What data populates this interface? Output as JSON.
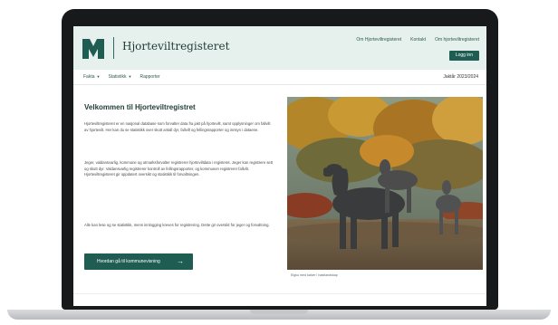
{
  "site": {
    "title": "Hjorteviltregisteret"
  },
  "header": {
    "links": [
      "Om Hjorteviltregisteret",
      "Kontakt",
      "Om hjorteviltregisteret"
    ],
    "login_label": "Logg inn"
  },
  "nav": {
    "items": [
      {
        "label": "Fakta",
        "has_dropdown": true
      },
      {
        "label": "Statistikk",
        "has_dropdown": true
      },
      {
        "label": "Rapporter",
        "has_dropdown": false
      }
    ],
    "hunt_year": "Jaktår 2023/2024"
  },
  "main": {
    "title": "Velkommen til Hjorteviltregistret",
    "paragraphs": [
      "Hjorteviltregisteret er en nasjonal database som forvalter data fra jakt på hjortevilt, samt opplysninger om fallvilt av hjortevilt. Her kan du se statistikk over skutt antall dyr, fallvilt og fellingsrapporter og innsyn i dataene.",
      "Jeger, valdansvarlig, kommune og utmarksforvalter registrerer hjorteviltdata i registeret. Jeger kan registrere sett og skutt dyr. Valdansvarlig registrerer kontroll av fellingsrapporter, og kommunen registrerer fallvilt. Hjorteviltregisteret gir oppdatert oversikt og statistikk til forvaltningen.",
      "Alle kan lese og se statistikk, mens innlogging kreves for registrering. Dette gir oversikt for jeger og forvaltning."
    ],
    "cta_label": "Hvordan gå til kommunevisning",
    "cta_icon": "arrow-right-icon"
  },
  "photo": {
    "caption": "Elgku med kalver i høstlandskap",
    "subject": "moose-in-autumn-forest"
  },
  "colors": {
    "brand": "#1f5c52",
    "header_bg": "#e6f0ed",
    "bezel": "#17191b"
  }
}
